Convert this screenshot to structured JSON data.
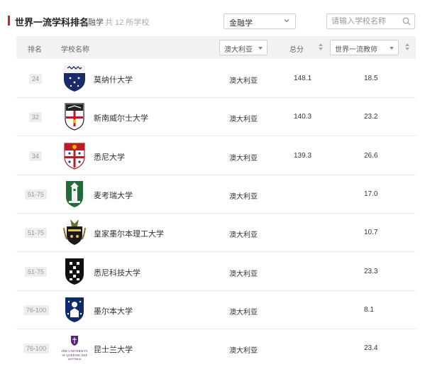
{
  "header": {
    "title": "世界一流学科排名",
    "subject": "金融学",
    "count_text": "共 12 所学校",
    "subject_select_value": "金融学",
    "search_placeholder": "请输入学校名称",
    "accent_color": "#d4202c"
  },
  "table": {
    "columns": {
      "rank": "排名",
      "name": "学校名称",
      "country_filter": "澳大利亚",
      "total": "总分",
      "metric_filter": "世界一流教师"
    },
    "rows": [
      {
        "rank": "24",
        "name": "莫纳什大学",
        "country": "澳大利亚",
        "total": "148.1",
        "metric": "18.5",
        "logo_icon": "monash-crest-icon"
      },
      {
        "rank": "32",
        "name": "新南威尔士大学",
        "country": "澳大利亚",
        "total": "140.3",
        "metric": "23.2",
        "logo_icon": "unsw-crest-icon"
      },
      {
        "rank": "34",
        "name": "悉尼大学",
        "country": "澳大利亚",
        "total": "139.3",
        "metric": "26.6",
        "logo_icon": "sydney-crest-icon"
      },
      {
        "rank": "51-75",
        "name": "麦考瑞大学",
        "country": "澳大利亚",
        "total": "",
        "metric": "17.0",
        "logo_icon": "macquarie-crest-icon"
      },
      {
        "rank": "51-75",
        "name": "皇家墨尔本理工大学",
        "country": "澳大利亚",
        "total": "",
        "metric": "10.7",
        "logo_icon": "rmit-crest-icon"
      },
      {
        "rank": "51-75",
        "name": "悉尼科技大学",
        "country": "澳大利亚",
        "total": "",
        "metric": "23.3",
        "logo_icon": "uts-crest-icon"
      },
      {
        "rank": "76-100",
        "name": "墨尔本大学",
        "country": "澳大利亚",
        "total": "",
        "metric": "8.1",
        "logo_icon": "melbourne-crest-icon"
      },
      {
        "rank": "76-100",
        "name": "昆士兰大学",
        "country": "澳大利亚",
        "total": "",
        "metric": "23.4",
        "logo_icon": "queensland-crest-icon",
        "logo_text": [
          "THE UNIVERSITY",
          "OF QUEENSLAND",
          "AUSTRALIA"
        ]
      }
    ]
  }
}
